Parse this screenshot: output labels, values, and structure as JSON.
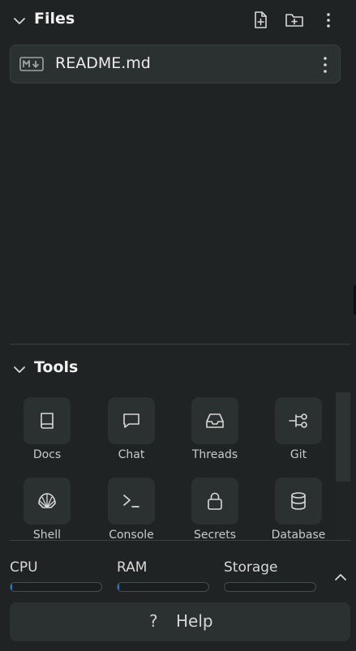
{
  "files": {
    "title": "Files",
    "new_file_icon": "file-plus-icon",
    "new_folder_icon": "folder-plus-icon",
    "menu_icon": "more-vertical-icon",
    "items": [
      {
        "name": "README.md",
        "icon": "markdown-icon"
      }
    ]
  },
  "tools": {
    "title": "Tools",
    "items": [
      {
        "label": "Docs",
        "icon": "book-icon"
      },
      {
        "label": "Chat",
        "icon": "chat-bubble-icon"
      },
      {
        "label": "Threads",
        "icon": "inbox-icon"
      },
      {
        "label": "Git",
        "icon": "git-branch-icon"
      },
      {
        "label": "Shell",
        "icon": "shell-icon"
      },
      {
        "label": "Console",
        "icon": "terminal-icon"
      },
      {
        "label": "Secrets",
        "icon": "lock-icon"
      },
      {
        "label": "Database",
        "icon": "database-icon"
      }
    ]
  },
  "resources": {
    "cpu": {
      "label": "CPU",
      "usage": 0.02
    },
    "ram": {
      "label": "RAM",
      "usage": 0.02
    },
    "storage": {
      "label": "Storage",
      "usage": 0.0
    }
  },
  "help": {
    "label": "Help",
    "icon": "question-mark-icon"
  },
  "colors": {
    "background": "#1f2324",
    "card": "#2b3031",
    "accent": "#1f7fd8"
  }
}
